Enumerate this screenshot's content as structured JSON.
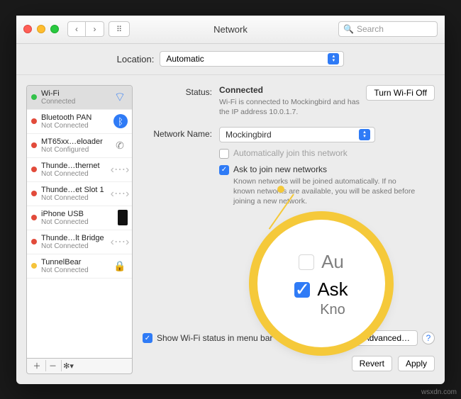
{
  "header": {
    "title": "Network",
    "search_placeholder": "Search"
  },
  "location": {
    "label": "Location:",
    "value": "Automatic"
  },
  "sidebar": {
    "items": [
      {
        "name": "Wi-Fi",
        "sub": "Connected",
        "status": "green",
        "icon": "wifi"
      },
      {
        "name": "Bluetooth PAN",
        "sub": "Not Connected",
        "status": "red",
        "icon": "bt"
      },
      {
        "name": "MT65xx…eloader",
        "sub": "Not Configured",
        "status": "red",
        "icon": "phone"
      },
      {
        "name": "Thunde…thernet",
        "sub": "Not Connected",
        "status": "red",
        "icon": "diamond"
      },
      {
        "name": "Thunde…et Slot 1",
        "sub": "Not Connected",
        "status": "red",
        "icon": "diamond"
      },
      {
        "name": "iPhone USB",
        "sub": "Not Connected",
        "status": "red",
        "icon": "usb"
      },
      {
        "name": "Thunde…lt Bridge",
        "sub": "Not Connected",
        "status": "red",
        "icon": "diamond"
      },
      {
        "name": "TunnelBear",
        "sub": "Not Connected",
        "status": "yellow",
        "icon": "lock"
      }
    ]
  },
  "main": {
    "status_label": "Status:",
    "status_value": "Connected",
    "turn_off": "Turn Wi-Fi Off",
    "status_desc": "Wi-Fi is connected to Mockingbird and has the IP address 10.0.1.7.",
    "network_name_label": "Network Name:",
    "network_name_value": "Mockingbird",
    "auto_join": "Automatically join this network",
    "ask_join": "Ask to join new networks",
    "ask_join_desc": "Known networks will be joined automatically. If no known networks are available, you will be asked before joining a new network.",
    "show_menubar": "Show Wi-Fi status in menu bar",
    "advanced": "Advanced…",
    "revert": "Revert",
    "apply": "Apply"
  },
  "zoom": {
    "row1": "Au",
    "row2": "Ask",
    "row3": "Kno"
  },
  "watermark": "wsxdn.com"
}
